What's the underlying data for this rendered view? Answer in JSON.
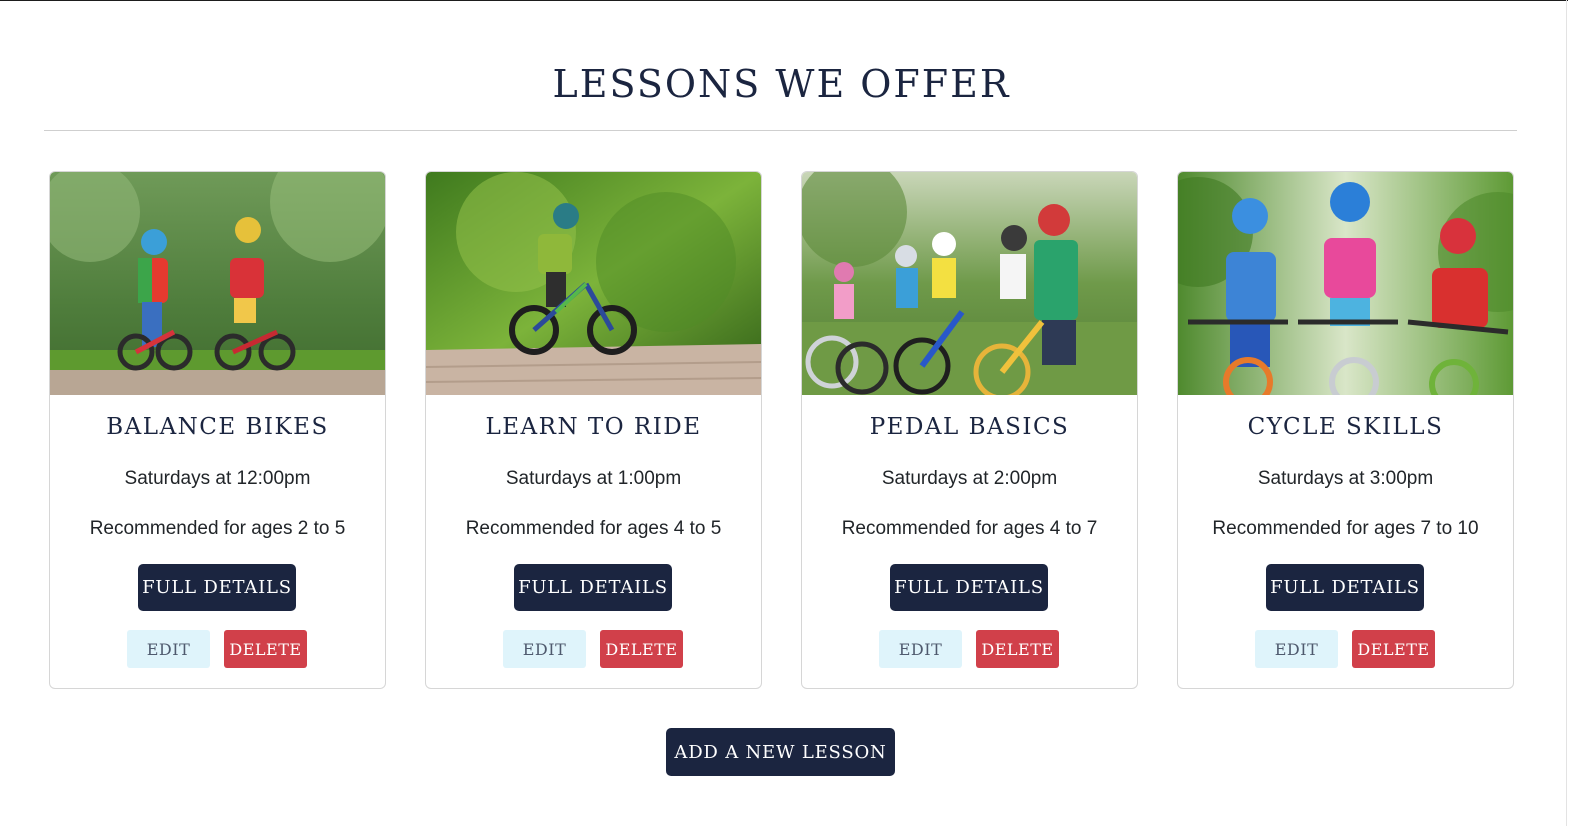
{
  "page": {
    "title": "LESSONS WE OFFER",
    "add_button_label": "ADD A NEW LESSON"
  },
  "lessons": [
    {
      "title": "BALANCE BIKES",
      "time": "Saturdays at 12:00pm",
      "ages": "Recommended for ages 2 to 5",
      "details_label": "FULL DETAILS",
      "edit_label": "EDIT",
      "delete_label": "DELETE",
      "image_alt": "two children riding balance bikes in a park"
    },
    {
      "title": "LEARN TO RIDE",
      "time": "Saturdays at 1:00pm",
      "ages": "Recommended for ages 4 to 5",
      "details_label": "FULL DETAILS",
      "edit_label": "EDIT",
      "delete_label": "DELETE",
      "image_alt": "child riding a small bike on a brick path"
    },
    {
      "title": "PEDAL BASICS",
      "time": "Saturdays at 2:00pm",
      "ages": "Recommended for ages 4 to 7",
      "details_label": "FULL DETAILS",
      "edit_label": "EDIT",
      "delete_label": "DELETE",
      "image_alt": "group of children with bikes and helmets"
    },
    {
      "title": "CYCLE SKILLS",
      "time": "Saturdays at 3:00pm",
      "ages": "Recommended for ages 7 to 10",
      "details_label": "FULL DETAILS",
      "edit_label": "EDIT",
      "delete_label": "DELETE",
      "image_alt": "three children riding bikes wearing helmets"
    }
  ],
  "colors": {
    "primary": "#1b2540",
    "edit_bg": "#dff4fb",
    "delete_bg": "#d1404a",
    "divider": "#cfcfcf"
  }
}
